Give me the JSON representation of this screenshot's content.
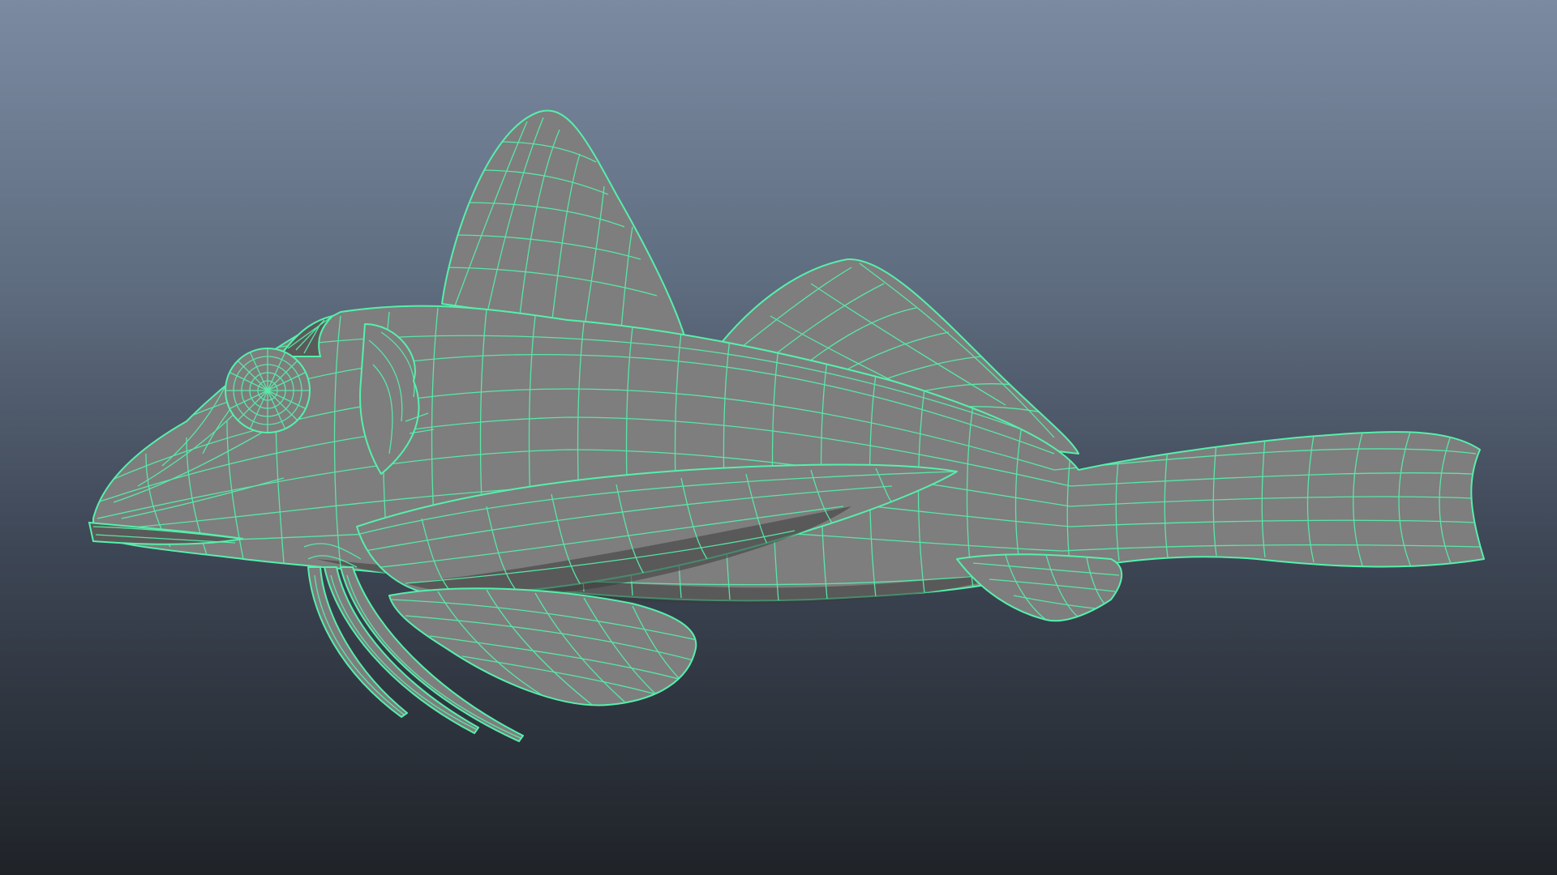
{
  "viewport": {
    "background_top": "#7b8aa1",
    "background_bottom": "#1f2328",
    "wireframe_color": "#55f0ab",
    "surface_color": "#7e7e7e",
    "model": "fish-mesh"
  }
}
